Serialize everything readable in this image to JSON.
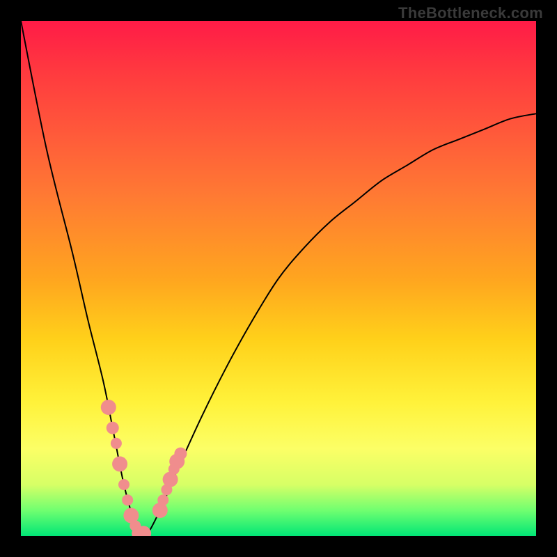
{
  "branding": {
    "text": "TheBottleneck.com"
  },
  "chart_data": {
    "type": "line",
    "title": "",
    "xlabel": "",
    "ylabel": "",
    "ylim": [
      0,
      100
    ],
    "xlim": [
      0,
      100
    ],
    "series": [
      {
        "name": "bottleneck-curve",
        "x": [
          0,
          5,
          10,
          13,
          16,
          18,
          20,
          22,
          24,
          27,
          30,
          35,
          40,
          45,
          50,
          55,
          60,
          65,
          70,
          75,
          80,
          85,
          90,
          95,
          100
        ],
        "values": [
          100,
          75,
          55,
          42,
          30,
          20,
          10,
          3,
          0,
          5,
          12,
          23,
          33,
          42,
          50,
          56,
          61,
          65,
          69,
          72,
          75,
          77,
          79,
          81,
          82
        ]
      }
    ],
    "markers": {
      "name": "highlight-points",
      "color": "#f08d8d",
      "x": [
        17,
        17.8,
        18.5,
        19.2,
        20,
        20.7,
        21.4,
        22.2,
        23,
        23.8,
        27,
        27.6,
        28.3,
        29,
        29.7,
        30.3,
        31
      ],
      "values": [
        25,
        21,
        18,
        14,
        10,
        7,
        4,
        2,
        0.5,
        0.5,
        5,
        7,
        9,
        11,
        13,
        14.5,
        16
      ],
      "size": [
        11,
        9,
        8,
        11,
        8,
        8,
        11,
        8,
        11,
        11,
        11,
        8,
        8,
        11,
        8,
        11,
        9
      ]
    },
    "gradient_stops": [
      {
        "pos": 0,
        "color": "#ff1b47"
      },
      {
        "pos": 50,
        "color": "#ffa51f"
      },
      {
        "pos": 74,
        "color": "#fff23a"
      },
      {
        "pos": 100,
        "color": "#00e676"
      }
    ]
  }
}
